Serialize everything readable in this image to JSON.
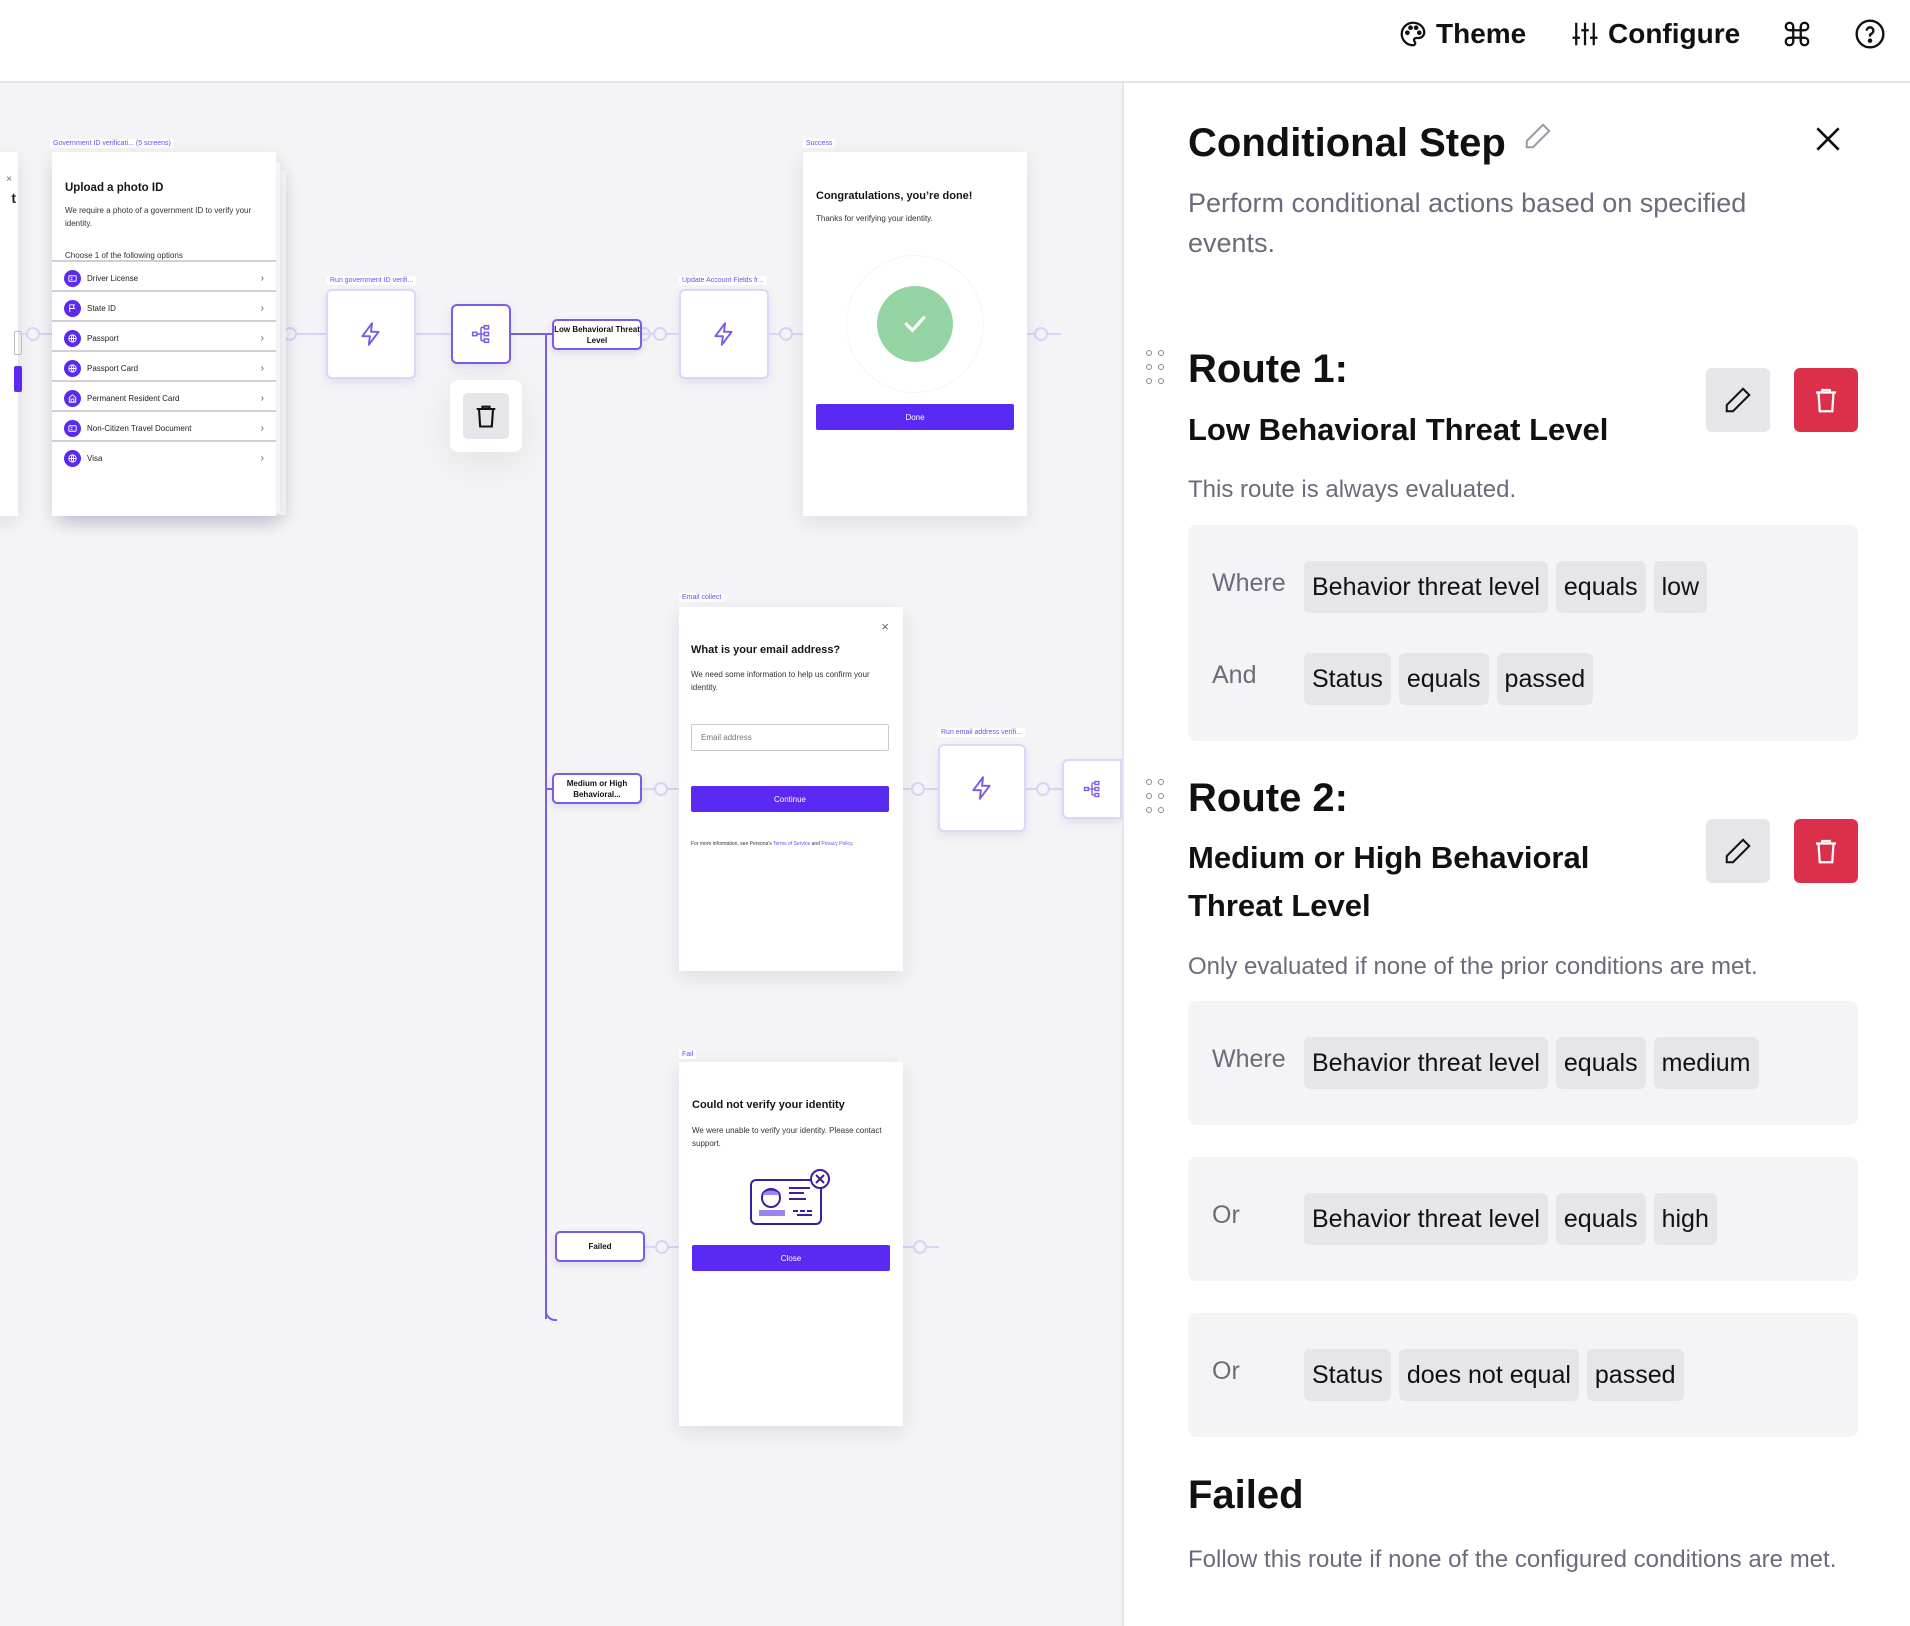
{
  "header": {
    "theme_label": "Theme",
    "configure_label": "Configure",
    "icons": [
      "palette-icon",
      "sliders-icon",
      "command-icon",
      "help-icon"
    ]
  },
  "canvas": {
    "gov_id": {
      "step_label": "Government ID verificati...  (5 screens)",
      "title": "Upload a photo ID",
      "body": "We require a photo of a government ID to verify your identity.",
      "choose_label": "Choose 1 of the following options",
      "options": [
        {
          "label": "Driver License",
          "icon": "id-card-icon"
        },
        {
          "label": "State ID",
          "icon": "flag-icon"
        },
        {
          "label": "Passport",
          "icon": "globe-icon"
        },
        {
          "label": "Passport Card",
          "icon": "globe-icon"
        },
        {
          "label": "Permanent Resident Card",
          "icon": "house-icon"
        },
        {
          "label": "Non-Citizen Travel Document",
          "icon": "id-card-icon"
        },
        {
          "label": "Visa",
          "icon": "globe-icon"
        }
      ]
    },
    "run_gov_id": {
      "step_label": "Run government ID verifi..."
    },
    "update_account": {
      "step_label": "Update Account Fields fr..."
    },
    "run_email": {
      "step_label": "Run email address verifi..."
    },
    "routes": {
      "low": "Low Behavioral Threat Level",
      "medium": "Medium or High Behavioral...",
      "failed": "Failed"
    },
    "success": {
      "step_label": "Success",
      "title": "Congratulations, you’re done!",
      "body": "Thanks for verifying your identity.",
      "button": "Done"
    },
    "email": {
      "step_label": "Email collect",
      "title": "What is your email address?",
      "body": "We need some information to help us confirm your identity.",
      "placeholder": "Email address",
      "button": "Continue",
      "footer_prefix": "For more information, see Persona's ",
      "terms": "Terms of Service",
      "and": " and ",
      "privacy": "Privacy Policy",
      "suffix": "."
    },
    "fail": {
      "step_label": "Fail",
      "title": "Could not verify your identity",
      "body": "We were unable to verify your identity. Please contact support.",
      "button": "Close"
    }
  },
  "panel": {
    "title": "Conditional Step",
    "description": "Perform conditional actions based on specified events.",
    "routes": [
      {
        "heading": "Route 1:",
        "name": "Low Behavioral Threat Level",
        "note": "This route is always evaluated.",
        "groups": [
          {
            "rows": [
              {
                "keyword": "Where",
                "chips": [
                  "Behavior threat level",
                  "equals",
                  "low"
                ]
              },
              {
                "keyword": "And",
                "chips": [
                  "Status",
                  "equals",
                  "passed"
                ]
              }
            ]
          }
        ]
      },
      {
        "heading": "Route 2:",
        "name": "Medium or High Behavioral Threat Level",
        "note": "Only evaluated if none of the prior conditions are met.",
        "groups": [
          {
            "rows": [
              {
                "keyword": "Where",
                "chips": [
                  "Behavior threat level",
                  "equals",
                  "medium"
                ]
              }
            ]
          },
          {
            "rows": [
              {
                "keyword": "Or",
                "chips": [
                  "Behavior threat level",
                  "equals",
                  "high"
                ]
              }
            ]
          },
          {
            "rows": [
              {
                "keyword": "Or",
                "chips": [
                  "Status",
                  "does not equal",
                  "passed"
                ]
              }
            ]
          }
        ]
      }
    ],
    "failed": {
      "heading": "Failed",
      "note": "Follow this route if none of the configured conditions are met."
    }
  },
  "colors": {
    "accent": "#5a2af3",
    "wire": "#7c5ce6",
    "danger": "#dc2f4a",
    "success": "#94d3a2"
  }
}
